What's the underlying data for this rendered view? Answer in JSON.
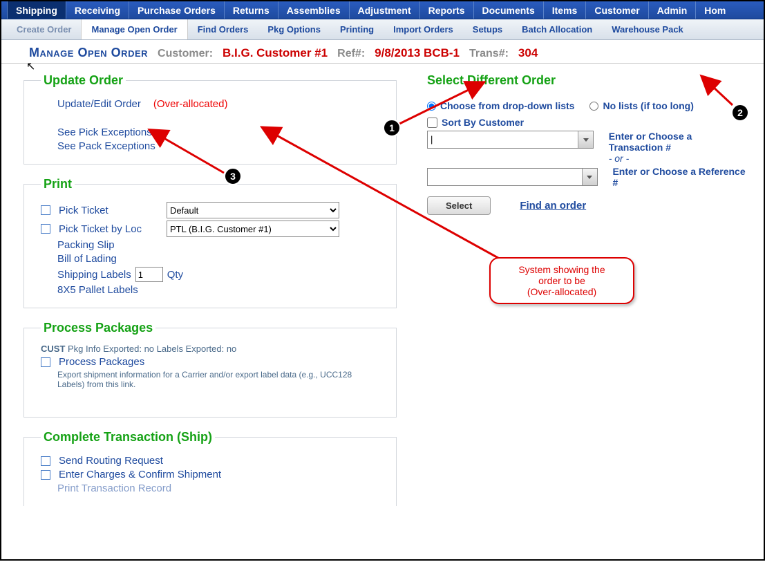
{
  "topnav": {
    "items": [
      "Shipping",
      "Receiving",
      "Purchase Orders",
      "Returns",
      "Assemblies",
      "Adjustment",
      "Reports",
      "Documents",
      "Items",
      "Customer",
      "Admin",
      "Hom"
    ]
  },
  "subnav": {
    "items": [
      "Create Order",
      "Manage Open Order",
      "Find Orders",
      "Pkg Options",
      "Printing",
      "Import Orders",
      "Setups",
      "Batch Allocation",
      "Warehouse Pack"
    ]
  },
  "header": {
    "title": "Manage Open Order",
    "customer_label": "Customer:",
    "customer_value": "B.I.G. Customer #1",
    "ref_label": "Ref#:",
    "ref_value": "9/8/2013 BCB-1",
    "trans_label": "Trans#:",
    "trans_value": "304"
  },
  "updateOrder": {
    "legend": "Update Order",
    "edit_link": "Update/Edit Order",
    "warning": "(Over-allocated)",
    "pick_exceptions": "See Pick Exceptions",
    "pack_exceptions": "See Pack Exceptions"
  },
  "print": {
    "legend": "Print",
    "pick_ticket": "Pick Ticket",
    "pick_ticket_default": "Default",
    "pick_ticket_loc": "Pick Ticket by Loc",
    "pick_ticket_loc_value": "PTL (B.I.G. Customer #1)",
    "packing_slip": "Packing Slip",
    "bill_of_lading": "Bill of Lading",
    "shipping_labels": "Shipping Labels",
    "shipping_qty": "1",
    "qty_label": "Qty",
    "pallet_labels": "8X5 Pallet Labels"
  },
  "process": {
    "legend": "Process Packages",
    "status_prefix": "CUST",
    "status_text": " Pkg Info Exported: no Labels Exported: no",
    "link": "Process Packages",
    "desc": "Export shipment information for a Carrier and/or export label data (e.g., UCC128 Labels) from this link."
  },
  "complete": {
    "legend": "Complete Transaction (Ship)",
    "routing": "Send Routing Request",
    "charges": "Enter Charges & Confirm Shipment",
    "print_record": "Print Transaction Record"
  },
  "selectOrder": {
    "legend": "Select Different Order",
    "radio_dropdown": "Choose from drop-down lists",
    "radio_nolists": "No lists (if too long)",
    "sort_by_cust": "Sort By Customer",
    "hint_trans": "Enter or Choose a Transaction #",
    "hint_or": "- or -",
    "hint_ref": "Enter or Choose a Reference #",
    "select_btn": "Select",
    "find_link": "Find an order",
    "combo1_value": "|"
  },
  "annotations": {
    "callout_line1": "System showing the",
    "callout_line2": "order to be",
    "callout_line3": "(Over-allocated)",
    "badge1": "1",
    "badge2": "2",
    "badge3": "3"
  }
}
